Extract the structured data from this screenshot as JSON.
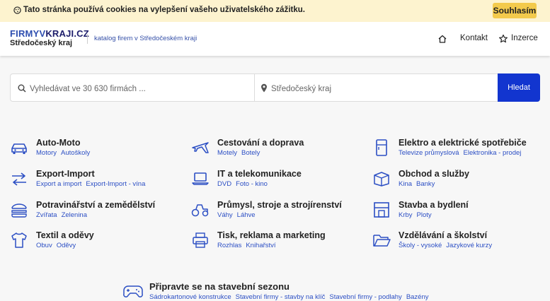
{
  "cookie": {
    "text": "Tato stránka používá cookies na vylepšení vašeho uživatelského zážitku.",
    "accept_label": "Souhlasím"
  },
  "header": {
    "logo_part1": "FIRMYV",
    "logo_part2": "KRAJI.CZ",
    "region": "Středočeský kraj",
    "tagline": "katalog firem v Středočeském kraji",
    "nav": {
      "kontakt": "Kontakt",
      "inzerce": "Inzerce"
    }
  },
  "search": {
    "query_placeholder": "Vyhledávat ve 30 630 firmách ...",
    "location_placeholder": "Středočeský kraj",
    "button_label": "Hledat"
  },
  "categories": [
    {
      "title": "Auto-Moto",
      "icon": "car-icon",
      "links": [
        "Motory",
        "Autoškoly"
      ]
    },
    {
      "title": "Cestování a doprava",
      "icon": "plane-icon",
      "links": [
        "Motely",
        "Botely"
      ]
    },
    {
      "title": "Elektro a elektrické spotřebiče",
      "icon": "fridge-icon",
      "links": [
        "Televize průmyslová",
        "Elektronika - prodej"
      ]
    },
    {
      "title": "Export-Import",
      "icon": "exchange-icon",
      "links": [
        "Export a import",
        "Export-Import - vína"
      ]
    },
    {
      "title": "IT a telekomunikace",
      "icon": "laptop-icon",
      "links": [
        "DVD",
        "Foto - kino"
      ]
    },
    {
      "title": "Obchod a služby",
      "icon": "box-icon",
      "links": [
        "Kina",
        "Banky"
      ]
    },
    {
      "title": "Potravinářství a zemědělství",
      "icon": "food-icon",
      "links": [
        "Zvířata",
        "Zelenina"
      ]
    },
    {
      "title": "Průmysl, stroje a strojírenství",
      "icon": "tractor-icon",
      "links": [
        "Váhy",
        "Láhve"
      ]
    },
    {
      "title": "Stavba a bydlení",
      "icon": "building-icon",
      "links": [
        "Krby",
        "Ploty"
      ]
    },
    {
      "title": "Textil a oděvy",
      "icon": "tshirt-icon",
      "links": [
        "Obuv",
        "Oděvy"
      ]
    },
    {
      "title": "Tisk, reklama a marketing",
      "icon": "printer-icon",
      "links": [
        "Rozhlas",
        "Knihařství"
      ]
    },
    {
      "title": "Vzdělávání a školství",
      "icon": "folder-icon",
      "links": [
        "Školy - vysoké",
        "Jazykové kurzy"
      ]
    }
  ],
  "promo": {
    "title": "Připravte se na stavební sezonu",
    "icon": "gamepad-icon",
    "links": [
      "Sádrokartonové konstrukce",
      "Stavební firmy - stavby na klíč",
      "Stavební firmy - podlahy",
      "Bazény"
    ]
  },
  "colors": {
    "accent": "#1235cf",
    "link": "#2c4fc4",
    "cookie_bg": "#fdf3cf",
    "cookie_btn": "#f3ca4c"
  }
}
